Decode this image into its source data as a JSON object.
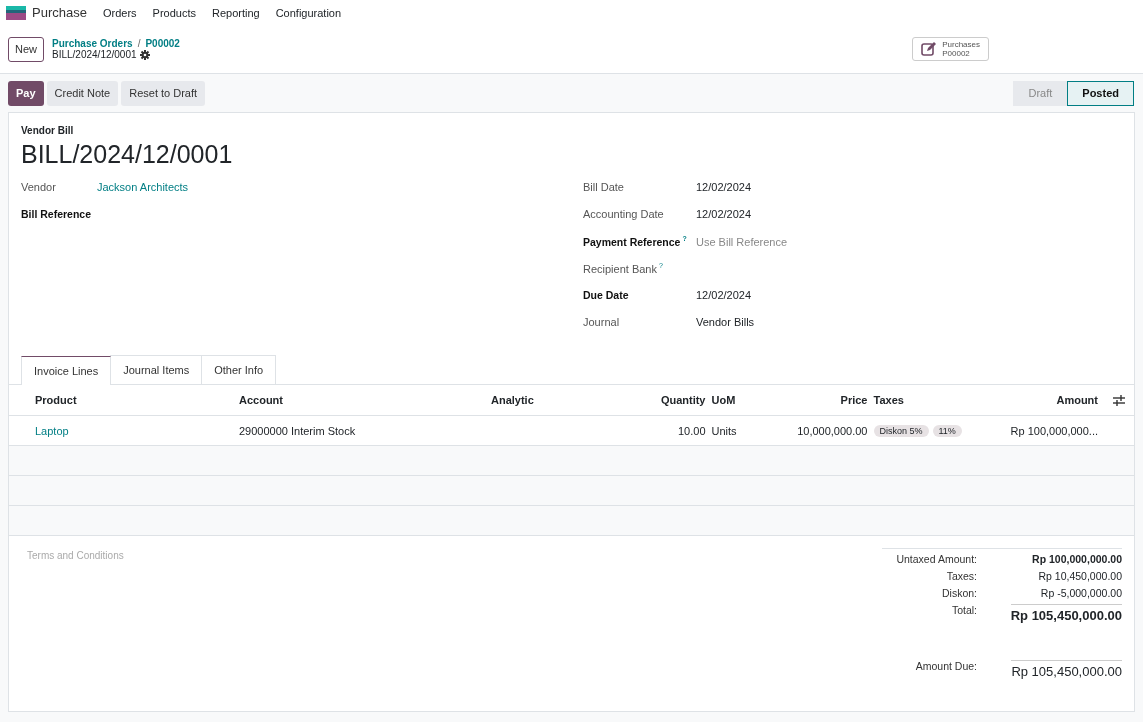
{
  "app": {
    "name": "Purchase"
  },
  "menu": [
    "Orders",
    "Products",
    "Reporting",
    "Configuration"
  ],
  "control_panel": {
    "new_button": "New",
    "breadcrumbs": [
      "Purchase Orders",
      "P00002"
    ],
    "breadcrumb_separator": "/",
    "record": "BILL/2024/12/0001",
    "smart_button": {
      "label": "Purchases",
      "value": "P00002"
    }
  },
  "actions": [
    {
      "label": "Pay",
      "kind": "primary"
    },
    {
      "label": "Credit Note",
      "kind": "secondary"
    },
    {
      "label": "Reset to Draft",
      "kind": "secondary"
    }
  ],
  "status_stages": [
    {
      "label": "Draft",
      "selected": false
    },
    {
      "label": "Posted",
      "selected": true
    }
  ],
  "form": {
    "type_label": "Vendor Bill",
    "title": "BILL/2024/12/0001",
    "left_fields": [
      {
        "label": "Vendor",
        "bold": false,
        "value": "Jackson Architects",
        "kind": "link"
      },
      {
        "label": "Bill Reference",
        "bold": true
      }
    ],
    "right_fields": [
      {
        "label": "Bill Date",
        "bold": false,
        "value": "12/02/2024",
        "kind": "text"
      },
      {
        "label": "Accounting Date",
        "bold": false,
        "value": "12/02/2024",
        "kind": "text"
      },
      {
        "label": "Payment Reference",
        "bold": true,
        "help": "?",
        "placeholder": "Use Bill Reference",
        "kind": "input"
      },
      {
        "label": "Recipient Bank",
        "bold": false,
        "help": "?"
      },
      {
        "label": "Due Date",
        "bold": true,
        "value": "12/02/2024",
        "kind": "text"
      },
      {
        "label": "Journal",
        "bold": false,
        "value": "Vendor Bills",
        "kind": "text"
      }
    ]
  },
  "tabs": [
    {
      "label": "Invoice Lines",
      "selected": true
    },
    {
      "label": "Journal Items",
      "selected": false
    },
    {
      "label": "Other Info",
      "selected": false
    }
  ],
  "table": {
    "columns": [
      "Product",
      "Account",
      "Analytic",
      "Quantity",
      "UoM",
      "Price",
      "Taxes",
      "Amount"
    ],
    "rows": [
      {
        "product": "Laptop",
        "account": "29000000 Interim Stock",
        "quantity": "10.00",
        "uom": "Units",
        "price": "10,000,000.00",
        "taxes": [
          "Diskon 5%",
          "11%"
        ],
        "amount": "Rp 100,000,000..."
      }
    ]
  },
  "terms_placeholder": "Terms and Conditions",
  "totals": [
    {
      "label": "Untaxed Amount:",
      "value": "Rp 100,000,000.00",
      "kind": "subtotal"
    },
    {
      "label": "Taxes:",
      "value": "Rp 10,450,000.00",
      "kind": "line"
    },
    {
      "label": "Diskon:",
      "value": "Rp -5,000,000.00",
      "kind": "line"
    },
    {
      "label": "Total:",
      "value": "Rp 105,450,000.00",
      "kind": "total"
    }
  ],
  "amount_due": {
    "label": "Amount Due:",
    "value": "Rp 105,450,000.00"
  }
}
